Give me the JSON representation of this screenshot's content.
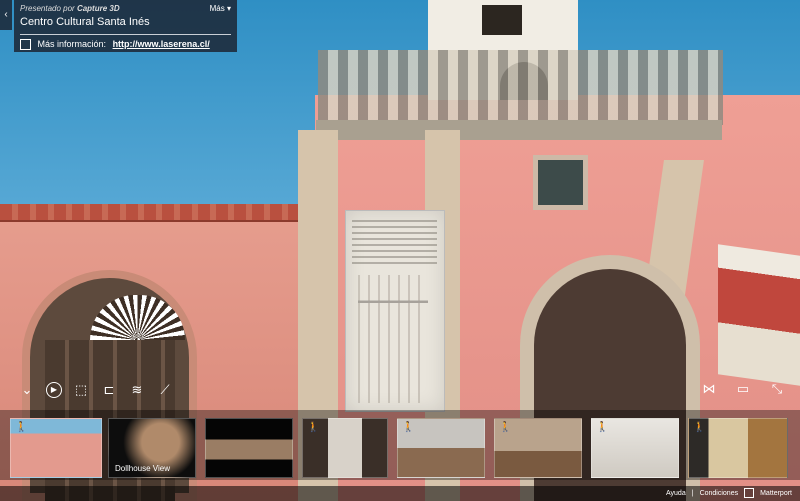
{
  "panel": {
    "collapse_arrow": "‹",
    "presented_prefix": "Presentado por",
    "presenter": "Capture 3D",
    "more_label": "Más",
    "title": "Centro Cultural Santa Inés",
    "more_info_label": "Más información:",
    "more_info_link": "http://www.laserena.cl/"
  },
  "thumbnails": [
    {
      "caption": ""
    },
    {
      "caption": "Dollhouse View"
    },
    {
      "caption": ""
    },
    {
      "caption": ""
    },
    {
      "caption": ""
    },
    {
      "caption": ""
    },
    {
      "caption": ""
    },
    {
      "caption": ""
    }
  ],
  "footer": {
    "help": "Ayuda",
    "separator": "|",
    "terms": "Condiciones",
    "brand": "Matterport"
  },
  "icons": {
    "chevron": "⌄",
    "play": "▶",
    "share": "⤴",
    "walk": "🚶"
  }
}
